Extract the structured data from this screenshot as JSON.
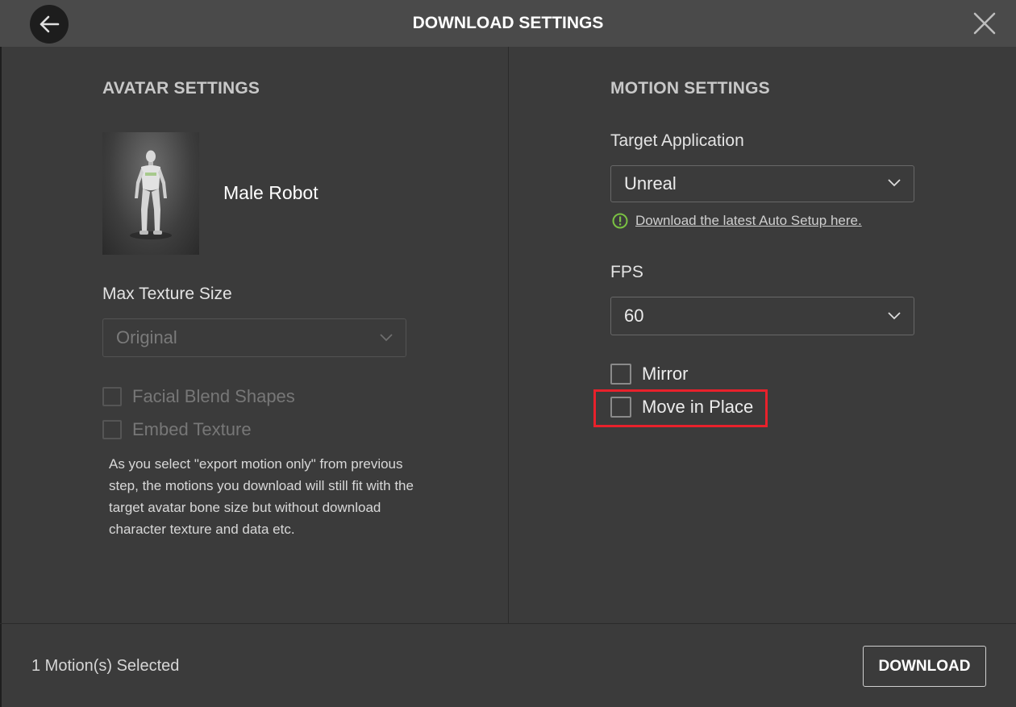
{
  "header": {
    "title": "DOWNLOAD SETTINGS",
    "back_icon": "arrow-left-icon",
    "close_icon": "close-icon"
  },
  "avatar_settings": {
    "title": "AVATAR SETTINGS",
    "avatar_name": "Male Robot",
    "max_texture_label": "Max Texture Size",
    "max_texture_value": "Original",
    "facial_blend_shapes_label": "Facial Blend Shapes",
    "embed_texture_label": "Embed Texture",
    "note": "As you select \"export motion only\" from previous step, the motions you download will still fit with the target avatar bone size but without download character texture and data etc."
  },
  "motion_settings": {
    "title": "MOTION SETTINGS",
    "target_app_label": "Target Application",
    "target_app_value": "Unreal",
    "autosetup_link": "Download the latest Auto Setup here.",
    "fps_label": "FPS",
    "fps_value": "60",
    "mirror_label": "Mirror",
    "move_in_place_label": "Move in Place"
  },
  "footer": {
    "status": "1 Motion(s) Selected",
    "download_label": "DOWNLOAD"
  },
  "colors": {
    "highlight": "#e8212b",
    "info_icon": "#7ac143"
  }
}
